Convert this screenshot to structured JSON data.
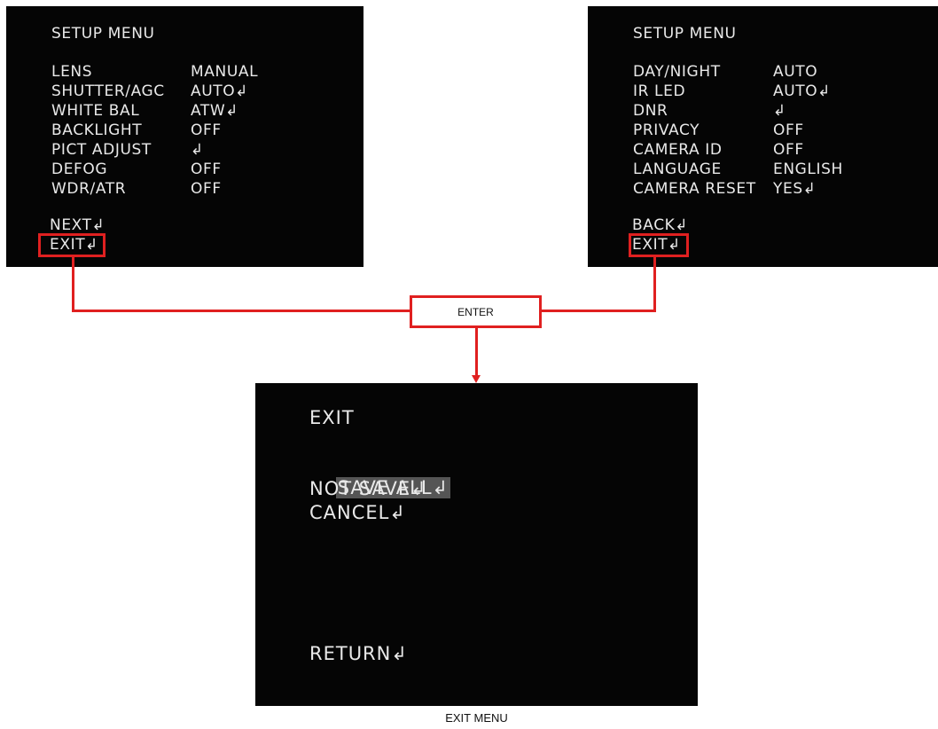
{
  "setup_menu_1": {
    "title": "SETUP MENU",
    "items": [
      {
        "label": "LENS",
        "value": "MANUAL"
      },
      {
        "label": "SHUTTER/AGC",
        "value": "AUTO↲"
      },
      {
        "label": "WHITE BAL",
        "value": "ATW↲"
      },
      {
        "label": "BACKLIGHT",
        "value": "OFF"
      },
      {
        "label": "PICT ADJUST",
        "value": "↲"
      },
      {
        "label": "DEFOG",
        "value": "OFF"
      },
      {
        "label": "WDR/ATR",
        "value": "OFF"
      }
    ],
    "next": "NEXT↲",
    "exit": "EXIT↲"
  },
  "setup_menu_2": {
    "title": "SETUP MENU",
    "items": [
      {
        "label": "DAY/NIGHT",
        "value": "AUTO"
      },
      {
        "label": "IR LED",
        "value": "AUTO↲"
      },
      {
        "label": "DNR",
        "value": "↲"
      },
      {
        "label": "PRIVACY",
        "value": "OFF"
      },
      {
        "label": "CAMERA ID",
        "value": "OFF"
      },
      {
        "label": "LANGUAGE",
        "value": "ENGLISH"
      },
      {
        "label": "CAMERA RESET",
        "value": "YES↲"
      }
    ],
    "back": "BACK↲",
    "exit": "EXIT↲"
  },
  "connector": {
    "label": "ENTER",
    "color": "#e02020"
  },
  "exit_menu": {
    "title": "EXIT",
    "options": [
      "SAVE ALL↲",
      "NOT SAVE↲",
      "CANCEL↲"
    ],
    "selected": "SAVE ALL↲",
    "return": "RETURN↲",
    "caption": "EXIT MENU"
  }
}
